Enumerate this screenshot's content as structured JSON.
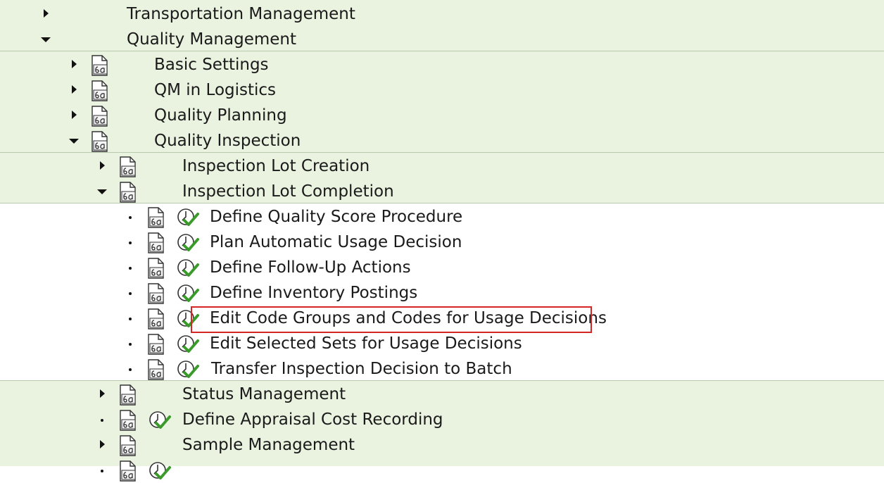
{
  "tree": {
    "top": [
      {
        "label": "Transportation Management",
        "expand": "collapsed"
      },
      {
        "label": "Quality Management",
        "expand": "expanded"
      }
    ],
    "qm_children": [
      {
        "label": "Basic Settings",
        "expand": "collapsed"
      },
      {
        "label": "QM in Logistics",
        "expand": "collapsed"
      },
      {
        "label": "Quality Planning",
        "expand": "collapsed"
      },
      {
        "label": "Quality Inspection",
        "expand": "expanded"
      }
    ],
    "inspection_children": [
      {
        "label": "Inspection Lot Creation",
        "expand": "collapsed"
      },
      {
        "label": "Inspection Lot Completion",
        "expand": "expanded"
      }
    ],
    "completion_activities": [
      {
        "label": "Define Quality Score Procedure"
      },
      {
        "label": "Plan Automatic Usage Decision"
      },
      {
        "label": "Define Follow-Up Actions"
      },
      {
        "label": "Define Inventory Postings"
      },
      {
        "label": "Edit Code Groups and Codes for Usage Decisions",
        "highlighted": true
      },
      {
        "label": "Edit Selected Sets for Usage Decisions"
      },
      {
        "label": "Transfer Inspection Decision to Batch"
      }
    ],
    "inspection_more": [
      {
        "label": "Status Management",
        "expand": "collapsed"
      },
      {
        "label": "Define Appraisal Cost Recording",
        "expand": "leaf"
      },
      {
        "label": "Sample Management",
        "expand": "collapsed"
      }
    ]
  },
  "icons": {
    "doc": "img-documentation-icon",
    "exec": "execute-activity-clock-check-icon"
  },
  "colors": {
    "band_green": "#eaf2e0",
    "highlight_border": "#d52525",
    "check_green": "#3a9a2a"
  }
}
